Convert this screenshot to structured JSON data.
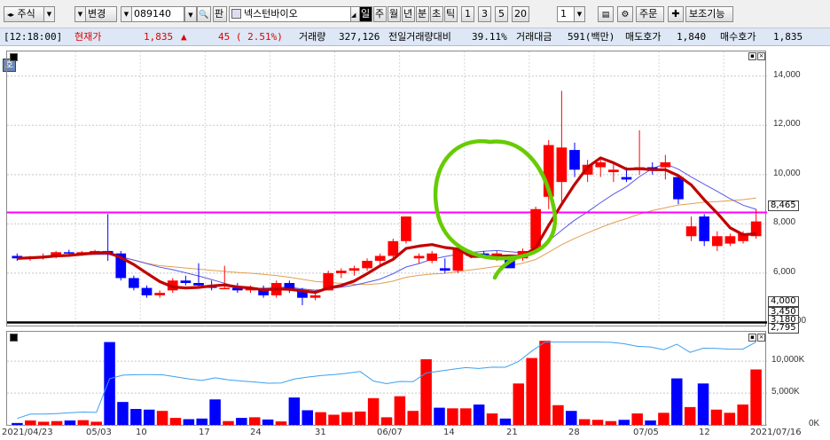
{
  "toolbar": {
    "nav_arrows": "◂▸",
    "category": "주식",
    "change_label": "변경",
    "stock_code": "089140",
    "search_label": "🔍",
    "pan_label": "판",
    "stock_name": "넥스턴바이오",
    "periods": [
      "일",
      "주",
      "월",
      "년",
      "분",
      "초",
      "틱"
    ],
    "active_period": "일",
    "intervals": [
      "1",
      "3",
      "5",
      "20"
    ],
    "interval_value": "1",
    "order_label": "주문",
    "aux_label": "보조기능"
  },
  "infobar": {
    "time": "[12:18:00]",
    "current_price_label": "현재가",
    "current_price": "1,835",
    "arrow": "▲",
    "change": "45 ( 2.51%)",
    "volume_label": "거래량",
    "volume": "327,126",
    "prev_vol_ratio_label": "전일거래량대비",
    "prev_vol_ratio": "39.11%",
    "trade_amount_label": "거래대금",
    "trade_amount": "591(백만)",
    "ask_label": "매도호가",
    "ask": "1,840",
    "bid_label": "매수호가",
    "bid": "1,835"
  },
  "side_button": "호",
  "price_boxes": {
    "ma_level": "8,465",
    "level_4000": "4,000",
    "l1": "3,450",
    "l2": "3,180",
    "l3": "2,795"
  },
  "colors": {
    "up": "#ff0000",
    "down": "#0000ff",
    "ma_thick": "#c00000",
    "ma_thin": "#5858e8",
    "ma_orange": "#e0a050",
    "hline": "#ff00ff",
    "circle": "#66cc00",
    "vol_line": "#3ba0f0"
  },
  "chart_data": [
    {
      "type": "candlestick",
      "y_ticks": [
        "14,000",
        "12,000",
        "10,000",
        "8,000",
        "6,000",
        "4,000"
      ],
      "ylim": [
        3800,
        15000
      ],
      "candles": [
        [
          6700,
          6800,
          6500,
          6600
        ],
        [
          6600,
          6700,
          6500,
          6650
        ],
        [
          6650,
          6800,
          6550,
          6700
        ],
        [
          6700,
          6900,
          6600,
          6850
        ],
        [
          6850,
          6950,
          6750,
          6800
        ],
        [
          6800,
          6900,
          6700,
          6850
        ],
        [
          6850,
          6950,
          6750,
          6900
        ],
        [
          6900,
          8400,
          6500,
          6800
        ],
        [
          6800,
          6900,
          5700,
          5800
        ],
        [
          5800,
          5900,
          5300,
          5400
        ],
        [
          5400,
          5500,
          5000,
          5100
        ],
        [
          5100,
          5300,
          5000,
          5200
        ],
        [
          5300,
          5800,
          5200,
          5700
        ],
        [
          5700,
          5900,
          5500,
          5600
        ],
        [
          5600,
          6400,
          5400,
          5500
        ],
        [
          5500,
          5700,
          5300,
          5400
        ],
        [
          5400,
          6300,
          5400,
          5400
        ],
        [
          5400,
          5600,
          5200,
          5300
        ],
        [
          5300,
          5500,
          5200,
          5400
        ],
        [
          5400,
          5500,
          5000,
          5100
        ],
        [
          5100,
          5700,
          5000,
          5600
        ],
        [
          5600,
          5700,
          5200,
          5300
        ],
        [
          5300,
          5400,
          4700,
          5000
        ],
        [
          5000,
          5300,
          4900,
          5100
        ],
        [
          5300,
          6100,
          5300,
          6000
        ],
        [
          6000,
          6200,
          5800,
          6100
        ],
        [
          6100,
          6300,
          5900,
          6200
        ],
        [
          6200,
          6600,
          6100,
          6500
        ],
        [
          6500,
          6800,
          6300,
          6700
        ],
        [
          6700,
          7400,
          6600,
          7300
        ],
        [
          7300,
          8300,
          7200,
          8300
        ],
        [
          6600,
          6800,
          6400,
          6700
        ],
        [
          6500,
          6900,
          6400,
          6800
        ],
        [
          6200,
          6600,
          6000,
          6100
        ],
        [
          6100,
          7100,
          6000,
          7000
        ],
        [
          6700,
          6900,
          6600,
          6800
        ],
        [
          6800,
          6900,
          6600,
          6700
        ],
        [
          6700,
          6900,
          6500,
          6800
        ],
        [
          6600,
          6700,
          6200,
          6200
        ],
        [
          6600,
          7000,
          6500,
          6900
        ],
        [
          7000,
          8700,
          6900,
          8600
        ],
        [
          9100,
          11400,
          8600,
          11200
        ],
        [
          9700,
          13400,
          8900,
          11100
        ],
        [
          11000,
          11300,
          9900,
          10200
        ],
        [
          10000,
          10600,
          9700,
          10400
        ],
        [
          10300,
          10600,
          9900,
          10500
        ],
        [
          10100,
          10500,
          9700,
          10200
        ],
        [
          9900,
          10300,
          9700,
          9800
        ],
        [
          10200,
          11800,
          10000,
          10300
        ],
        [
          10300,
          10500,
          10000,
          10200
        ],
        [
          10300,
          10800,
          9800,
          10500
        ],
        [
          9900,
          10000,
          8800,
          9000
        ],
        [
          7500,
          8300,
          7300,
          7900
        ],
        [
          8300,
          8400,
          7100,
          7300
        ],
        [
          7100,
          7700,
          6900,
          7500
        ],
        [
          7200,
          7600,
          7100,
          7500
        ],
        [
          7300,
          7700,
          7200,
          7600
        ],
        [
          7500,
          8600,
          7400,
          8100
        ]
      ]
    },
    {
      "type": "bar",
      "categories": [
        "2021/04/23",
        "05/03",
        "10",
        "17",
        "24",
        "31",
        "06/07",
        "14",
        "21",
        "28",
        "07/05",
        "12",
        "2021/07/16"
      ],
      "y_ticks": [
        "10,000K",
        "5,000K",
        "0K"
      ],
      "ylim": [
        0,
        13500
      ],
      "values": [
        300,
        700,
        500,
        600,
        700,
        750,
        500,
        13000,
        3600,
        2500,
        2400,
        2200,
        1100,
        900,
        1000,
        4000,
        600,
        1100,
        1200,
        850,
        550,
        4300,
        2300,
        2000,
        1600,
        2000,
        2100,
        4200,
        1200,
        4500,
        2200,
        10300,
        2700,
        2600,
        2600,
        3200,
        1800,
        1000,
        6500,
        10500,
        13200,
        3100,
        2200,
        900,
        800,
        600,
        800,
        1800,
        700,
        1900,
        7300,
        2800,
        6500,
        2400,
        1900,
        3200,
        8700
      ]
    }
  ]
}
